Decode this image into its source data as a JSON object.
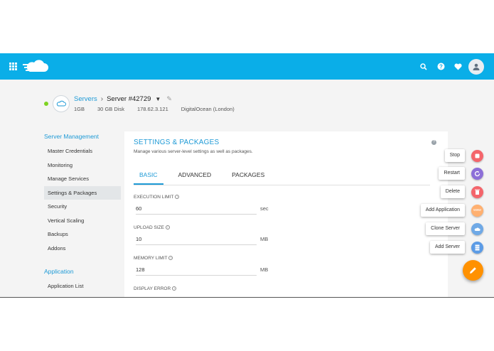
{
  "header": {
    "icons": [
      "apps-grid-icon",
      "cloudways-logo",
      "search-icon",
      "help-icon",
      "heart-icon",
      "user-avatar-icon"
    ]
  },
  "colors": {
    "topbar": "#0aaee8",
    "accent": "#1e9ad6",
    "status_online": "#7ed321",
    "fab_orange": "#ff9100"
  },
  "server": {
    "breadcrumb_root": "Servers",
    "breadcrumb_sep": "›",
    "name": "Server #42729",
    "meta": [
      "1GB",
      "30 GB Disk",
      "178.62.3.121",
      "DigitalOcean (London)"
    ]
  },
  "sidebar": {
    "server_heading": "Server Management",
    "server_items": [
      "Master Credentials",
      "Monitoring",
      "Manage Services",
      "Settings & Packages",
      "Security",
      "Vertical Scaling",
      "Backups",
      "Addons"
    ],
    "app_heading": "Application",
    "app_items": [
      "Application List"
    ]
  },
  "panel": {
    "title": "SETTINGS & PACKAGES",
    "subtitle": "Manage various server-level settings as well as packages.",
    "tabs": [
      "BASIC",
      "ADVANCED",
      "PACKAGES"
    ],
    "fields": [
      {
        "label": "EXECUTION LIMIT",
        "value": "60",
        "unit": "sec"
      },
      {
        "label": "UPLOAD SIZE",
        "value": "10",
        "unit": "MB"
      },
      {
        "label": "MEMORY LIMIT",
        "value": "128",
        "unit": "MB"
      },
      {
        "label": "DISPLAY ERROR",
        "value": "",
        "unit": ""
      }
    ]
  },
  "actions": [
    {
      "label": "Stop",
      "icon": "stop-icon",
      "color": "#f4656b"
    },
    {
      "label": "Restart",
      "icon": "restart-icon",
      "color": "#8c6fd8"
    },
    {
      "label": "Delete",
      "icon": "trash-icon",
      "color": "#f4656b"
    },
    {
      "label": "Add Application",
      "icon": "www-icon",
      "color": "#ffb070"
    },
    {
      "label": "Clone Server",
      "icon": "clone-server-icon",
      "color": "#6fa9e6"
    },
    {
      "label": "Add Server",
      "icon": "add-server-icon",
      "color": "#5b9be6"
    }
  ]
}
